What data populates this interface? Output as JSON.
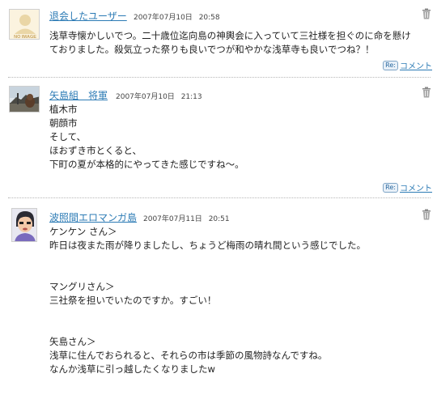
{
  "comments": [
    {
      "author": "退会したユーザー",
      "date": "2007年07月10日",
      "time": "20:58",
      "avatar": "no-image",
      "avatar_label": "NO IMAGE",
      "lines": [
        "浅草寺懐かしいでつ。二十歳位迄向島の神輿会に入っていて三社様を担ぐのに命を懸け",
        "ておりました。殺気立った祭りも良いでつが和やかな浅草寺も良いでつね？！"
      ],
      "reply_badge": "Re:",
      "reply_label": "コメント"
    },
    {
      "author": "矢島組　将軍",
      "date": "2007年07月10日",
      "time": "21:13",
      "avatar": "photo-dog",
      "lines": [
        "植木市",
        "朝顔市",
        "そして、",
        "ほおずき市とくると、",
        "下町の夏が本格的にやってきた感じですね〜。"
      ],
      "reply_badge": "Re:",
      "reply_label": "コメント"
    },
    {
      "author": "波照間エロマンガ島",
      "date": "2007年07月11日",
      "time": "20:51",
      "avatar": "cartoon-face",
      "lines": [
        "ケンケン さん＞",
        "昨日は夜また雨が降りましたし、ちょうど梅雨の晴れ間という感じでした。",
        "",
        "",
        "マングリさん＞",
        "三社祭を担いでいたのですか。すごい！",
        "",
        "",
        "矢島さん＞",
        "浅草に住んでおられると、それらの市は季節の風物詩なんですね。",
        "なんか浅草に引っ越したくなりましたw"
      ]
    }
  ],
  "colors": {
    "link": "#2c7bb5",
    "text": "#222222",
    "separator": "#b7b7b7"
  }
}
